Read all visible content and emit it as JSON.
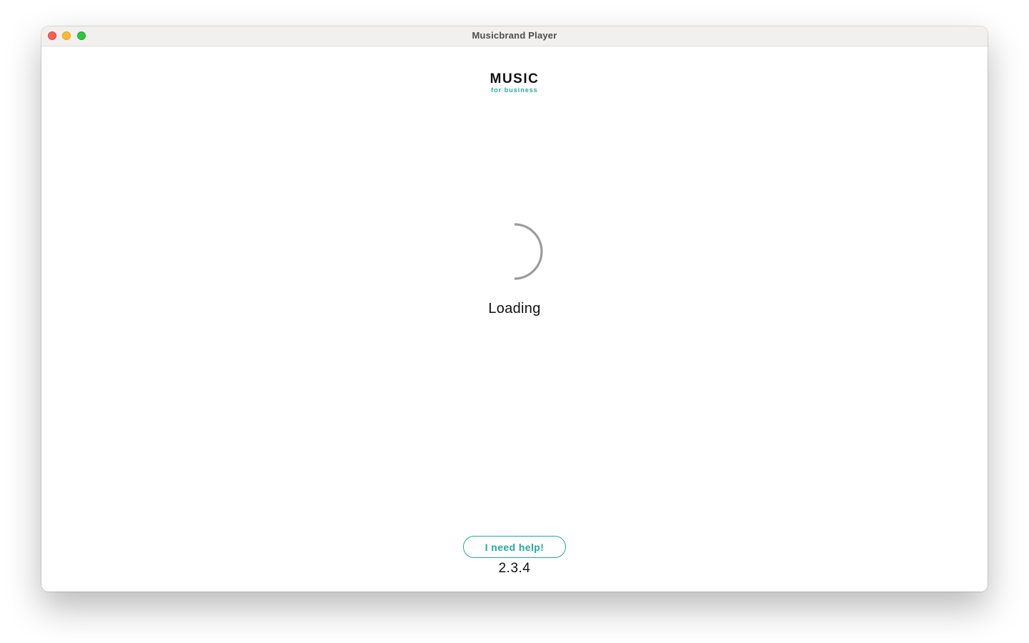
{
  "window": {
    "title": "Musicbrand Player"
  },
  "logo": {
    "main": "MUSIC",
    "sub": "for business"
  },
  "status": {
    "text": "Loading",
    "icon": "loading-spinner-icon"
  },
  "footer": {
    "help_button": "I need help!",
    "version": "2.3.4"
  },
  "colors": {
    "accent": "#22a99a",
    "spinner": "#9b9b9b",
    "text": "#111111",
    "titlebar": "#f1f0ef"
  }
}
